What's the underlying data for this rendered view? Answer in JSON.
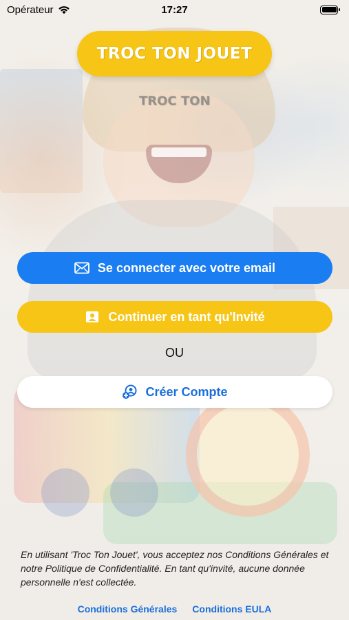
{
  "status_bar": {
    "carrier": "Opérateur",
    "time": "17:27"
  },
  "logo": {
    "title": "TROC TON JOUET"
  },
  "subtitle": "TROC TON",
  "buttons": {
    "email_login": "Se connecter avec votre email",
    "guest": "Continuer en tant qu'Invité",
    "create_account": "Créer Compte"
  },
  "separator": "OU",
  "legal_text": "En utilisant 'Troc Ton Jouet', vous acceptez nos Conditions Générales et notre Politique de Confidentialité. En tant qu'invité, aucune donnée personnelle n'est collectée.",
  "footer_links": {
    "terms": "Conditions Générales",
    "eula": "Conditions EULA"
  },
  "colors": {
    "brand_yellow": "#f6c516",
    "primary_blue": "#1a7df2",
    "link_blue": "#1a6fdc"
  },
  "icons": {
    "email_button": "envelope-icon",
    "guest_button": "person-card-icon",
    "create_button": "add-user-icon",
    "status_wifi": "wifi-icon",
    "status_battery": "battery-icon"
  }
}
